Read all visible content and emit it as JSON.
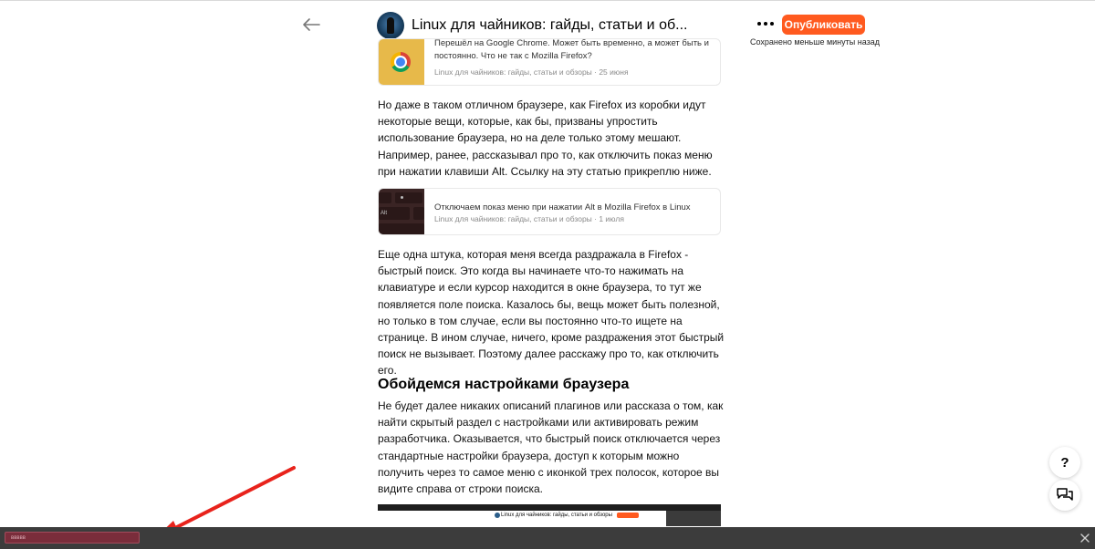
{
  "header": {
    "channel_title": "Linux для чайников: гайды, статьи и об...",
    "publish_label": "Опубликовать",
    "saved_status": "Сохранено меньше минуты назад"
  },
  "article": {
    "cards": [
      {
        "title": "Перешёл на Google Chrome. Может быть временно, а может быть и постоянно. Что не так с Mozilla Firefox?",
        "title_line1": "Перешёл на Google Chrome. Может быть временно, а может быть и",
        "title_line2": "постоянно. Что не так с Mozilla Firefox?",
        "meta": "Linux для чайников: гайды, статьи и обзоры · 25 июня",
        "thumb_icon": "chrome-logo-icon"
      },
      {
        "title": "Отключаем показ меню при нажатии Alt в Mozilla Firefox в Linux",
        "meta": "Linux для чайников: гайды, статьи и обзоры · 1 июля",
        "thumb_icon": "keyboard-alt-icon"
      }
    ],
    "paragraphs": [
      "Но даже в таком отличном браузере, как Firefox из коробки идут некоторые вещи, которые, как бы, призваны упростить использование браузера, но на деле только этому мешают. Например, ранее, рассказывал про то, как отключить показ меню при нажатии клавиши Alt. Ссылку на эту статью прикреплю ниже.",
      "Еще одна штука, которая меня всегда раздражала в Firefox - быстрый поиск. Это когда вы начинаете что-то нажимать на клавиатуре и если курсор находится в окне браузера, то тут же появляется поле поиска. Казалось бы, вещь может быть полезной, но только в том случае, если вы постоянно что-то ищете на странице. В ином случае, ничего, кроме раздражения этот быстрый поиск не вызывает. Поэтому далее расскажу про то, как отключить его.",
      "Не будет далее никаких описаний плагинов или рассказа о том, как найти скрытый раздел с настройками или активировать режим разработчика. Оказывается, что быстрый поиск отключается через стандартные настройки браузера, доступ к которым можно получить через то самое меню с иконкой трех полосок, которое вы видите справа от строки поиска."
    ],
    "heading": "Обойдемся настройками браузера",
    "embed_title": "Linux для чайников: гайды, статьи и обзоры"
  },
  "floating": {
    "help_label": "?",
    "help_icon": "question-icon",
    "chat_icon": "feedback-chat-icon"
  },
  "bottom_bar": {
    "field_value": "ввввв",
    "close_icon": "close-icon"
  },
  "colors": {
    "accent": "#ff5a1f",
    "annotation_arrow": "#e8231c",
    "bottom_bar": "#3c3c3c",
    "bottom_field": "#7a2d3b"
  }
}
